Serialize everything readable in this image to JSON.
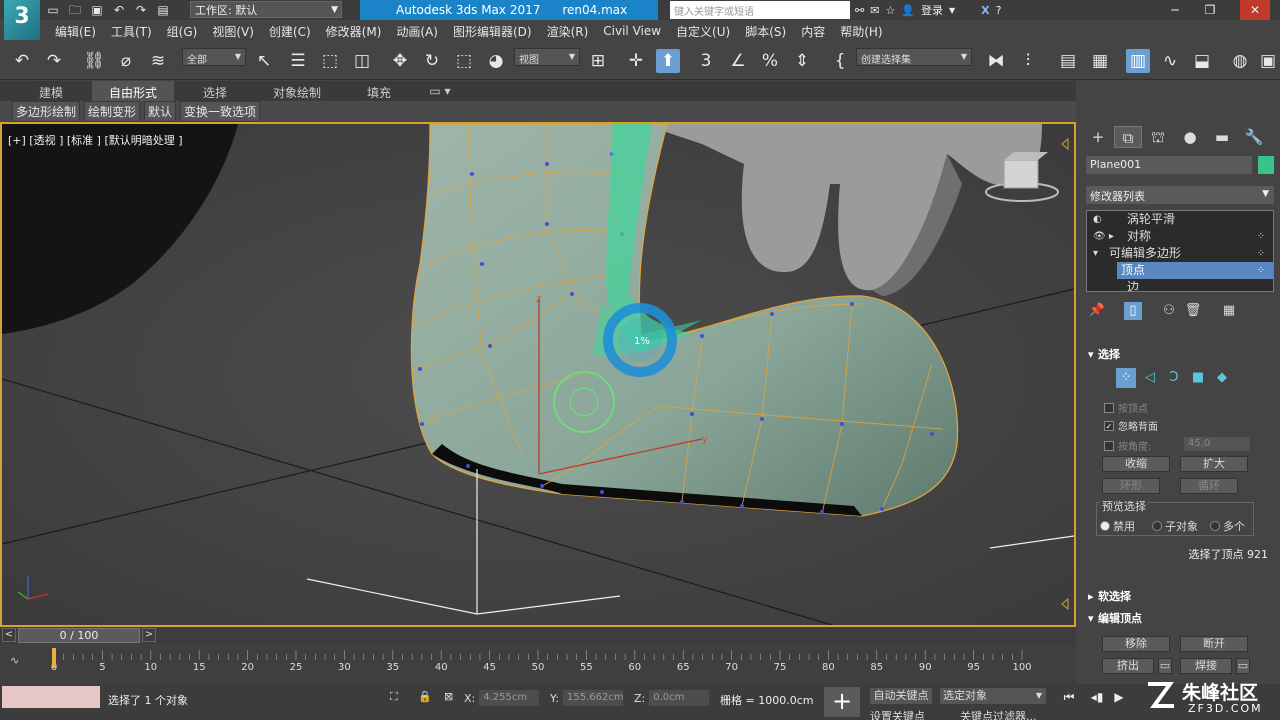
{
  "titlebar": {
    "logo": "3",
    "workspace_label": "工作区: 默认",
    "app_title": "Autodesk 3ds Max 2017",
    "file_name": "ren04.max",
    "search_placeholder": "键入关键字或短语",
    "login_label": "登录"
  },
  "menu": [
    "编辑(E)",
    "工具(T)",
    "组(G)",
    "视图(V)",
    "创建(C)",
    "修改器(M)",
    "动画(A)",
    "图形编辑器(D)",
    "渲染(R)",
    "Civil View",
    "自定义(U)",
    "脚本(S)",
    "内容",
    "帮助(H)"
  ],
  "toolbar": {
    "selection_filter": "全部",
    "ref_coord": "视图",
    "named_selection": "创建选择集"
  },
  "ribbon": {
    "tabs": [
      "建模",
      "自由形式",
      "选择",
      "对象绘制",
      "填充"
    ],
    "active_tab": "自由形式",
    "subtabs": [
      "多边形绘制",
      "绘制变形",
      "默认",
      "变换一致选项"
    ]
  },
  "viewport": {
    "label": "[+] [透视 ] [标准 ] [默认明暗处理 ]",
    "brush_strength": "1%",
    "gizmo_axes": {
      "z": "z",
      "y": "y"
    }
  },
  "command_panel": {
    "object_name": "Plane001",
    "object_color": "#3ac28d",
    "modifier_list_label": "修改器列表",
    "stack": [
      {
        "label": "涡轮平滑",
        "selected": false
      },
      {
        "label": "对称",
        "selected": false
      },
      {
        "label": "可编辑多边形",
        "selected": false
      },
      {
        "label": "顶点",
        "selected": true
      },
      {
        "label": "边",
        "selected": false
      }
    ],
    "selection": {
      "title": "选择",
      "by_vertex": "按顶点",
      "ignore_backfacing": "忽略背面",
      "by_angle": "按角度:",
      "angle_value": "45.0",
      "shrink": "收缩",
      "grow": "扩大",
      "ring": "环形",
      "loop": "循环",
      "preview_title": "预览选择",
      "preview_options": [
        "禁用",
        "子对象",
        "多个"
      ],
      "preview_selected": "禁用",
      "info": "选择了顶点 921"
    },
    "soft_selection_title": "软选择",
    "edit_vertices": {
      "title": "编辑顶点",
      "remove": "移除",
      "break": "断开",
      "extrude": "挤出",
      "weld": "焊接"
    }
  },
  "timeline": {
    "range_label": "0 / 100",
    "ticks": [
      "0",
      "5",
      "10",
      "15",
      "20",
      "25",
      "30",
      "35",
      "40",
      "45",
      "50",
      "55",
      "60",
      "65",
      "70",
      "75",
      "80",
      "85",
      "90",
      "95",
      "100"
    ]
  },
  "status": {
    "message": "选择了 1 个对象",
    "x_label": "X:",
    "x_value": "4.255cm",
    "y_label": "Y:",
    "y_value": "155.662cm",
    "z_label": "Z:",
    "z_value": "0.0cm",
    "grid": "栅格 = 1000.0cm",
    "autokey": "自动关键点",
    "setkey_filter": "选定对象",
    "second_row_a": "设置关键点",
    "second_row_b": "关键点过滤器..."
  },
  "watermark": {
    "brand": "朱峰社区",
    "url": "ZF3D.COM"
  }
}
